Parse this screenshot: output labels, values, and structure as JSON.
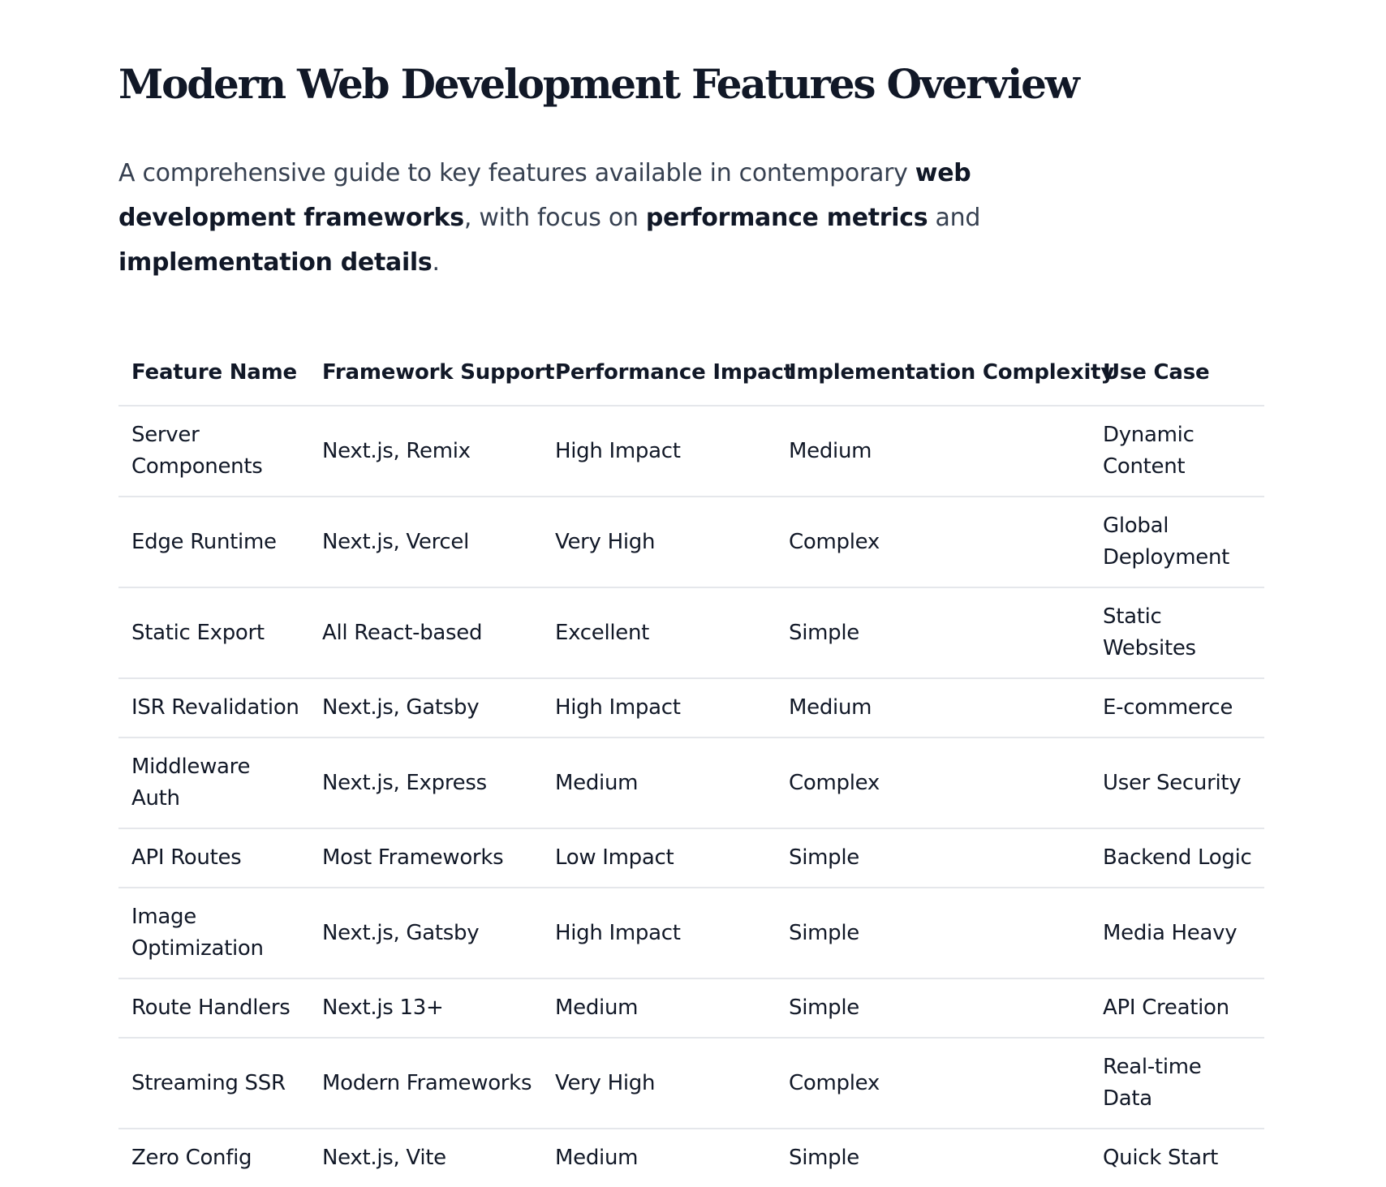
{
  "title": "Modern Web Development Features Overview",
  "intro": {
    "part1": "A comprehensive guide to key features available in contemporary ",
    "bold1": "web development frameworks",
    "part2": ", with focus on ",
    "bold2": "performance metrics",
    "part3": " and ",
    "bold3": "implementation details",
    "part4": "."
  },
  "table": {
    "headers": [
      "Feature Name",
      "Framework Support",
      "Performance Impact",
      "Implementation Complexity",
      "Use Case"
    ],
    "rows": [
      [
        "Server Components",
        "Next.js, Remix",
        "High Impact",
        "Medium",
        "Dynamic Content"
      ],
      [
        "Edge Runtime",
        "Next.js, Vercel",
        "Very High",
        "Complex",
        "Global Deployment"
      ],
      [
        "Static Export",
        "All React-based",
        "Excellent",
        "Simple",
        "Static Websites"
      ],
      [
        "ISR Revalidation",
        "Next.js, Gatsby",
        "High Impact",
        "Medium",
        "E-commerce"
      ],
      [
        "Middleware Auth",
        "Next.js, Express",
        "Medium",
        "Complex",
        "User Security"
      ],
      [
        "API Routes",
        "Most Frameworks",
        "Low Impact",
        "Simple",
        "Backend Logic"
      ],
      [
        "Image Optimization",
        "Next.js, Gatsby",
        "High Impact",
        "Simple",
        "Media Heavy"
      ],
      [
        "Route Handlers",
        "Next.js 13+",
        "Medium",
        "Simple",
        "API Creation"
      ],
      [
        "Streaming SSR",
        "Modern Frameworks",
        "Very High",
        "Complex",
        "Real-time Data"
      ],
      [
        "Zero Config",
        "Next.js, Vite",
        "Medium",
        "Simple",
        "Quick Start"
      ]
    ]
  }
}
